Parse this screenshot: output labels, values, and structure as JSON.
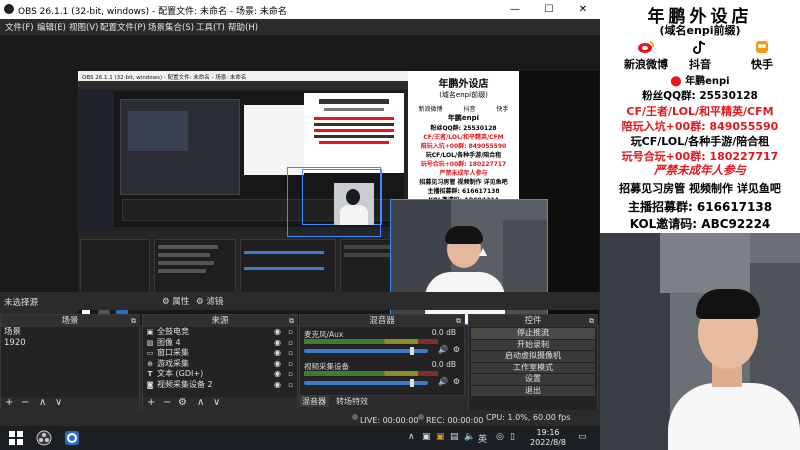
{
  "obs": {
    "title": "OBS 26.1.1 (32-bit, windows) - 配置文件: 未命名 - 场景: 未命名",
    "menu": [
      "文件(F)",
      "编辑(E)",
      "视图(V)",
      "配置文件(P)",
      "场景集合(S)",
      "工具(T)",
      "帮助(H)"
    ],
    "window_buttons": {
      "minimize": "—",
      "maximize": "☐",
      "close": "✕"
    },
    "nested_title": "OBS 26.1.1 (32-bit, windows) - 配置文件: 未命名 - 场景: 未命名",
    "no_source_selected": "未选择源",
    "properties_btn": "属性",
    "filters_btn": "滤镜",
    "docks": {
      "scenes": {
        "title": "场景",
        "items": [
          "场景",
          "1920"
        ]
      },
      "sources": {
        "title": "来源",
        "items": [
          {
            "icon": "window-capture-icon",
            "label": "全鼓电竞"
          },
          {
            "icon": "image-icon",
            "label": "图像 4"
          },
          {
            "icon": "window-capture-icon",
            "label": "窗口采集"
          },
          {
            "icon": "game-capture-icon",
            "label": "游戏采集"
          },
          {
            "icon": "text-icon",
            "label": "文本 (GDI+)"
          },
          {
            "icon": "camera-icon",
            "label": "视频采集设备 2"
          }
        ]
      },
      "mixer": {
        "title": "混音器",
        "channels": [
          {
            "name": "麦克风/Aux",
            "db": "0.0 dB",
            "level": 0.85
          },
          {
            "name": "视频采集设备",
            "db": "0.0 dB",
            "level": 0.85
          }
        ],
        "tabs": [
          "混音器",
          "转场特效"
        ]
      },
      "controls": {
        "title": "控件",
        "buttons": [
          "停止推流",
          "开始录制",
          "启动虚拟摄像机",
          "工作室模式",
          "设置",
          "退出"
        ]
      }
    },
    "status": {
      "live": "LIVE: 00:00:00",
      "rec": "REC: 00:00:00",
      "cpu": "CPU: 1.0%, 60.00 fps"
    }
  },
  "taskbar": {
    "time": "19:16",
    "date": "2022/8/8"
  },
  "poster": {
    "title": "年鹏外设店",
    "subtitle": "(域名enpi前缀)",
    "social": [
      "新浪微博",
      "抖音",
      "快手"
    ],
    "name": "年鹏enpi",
    "lines": [
      {
        "text": "粉丝QQ群: 25530128",
        "color": "#000000"
      },
      {
        "text": "CF/王者/LOL/和平精英/CFM",
        "color": "#e3171c"
      },
      {
        "text": "陪玩入坑+00群: 849055590",
        "color": "#e3171c"
      },
      {
        "text": "玩CF/LOL/各种手游/陪合租",
        "color": "#000000"
      },
      {
        "text": "玩号合玩+00群: 180227717",
        "color": "#e3171c"
      },
      {
        "text": "严禁未成年人参与",
        "color": "#e3171c"
      },
      {
        "text": "招募见习房管 视频制作 详见鱼吧",
        "color": "#000000"
      },
      {
        "text": "主播招募群: 616617138",
        "color": "#000000"
      },
      {
        "text": "KOL邀请码: ABC92224",
        "color": "#000000"
      }
    ]
  },
  "colors": {
    "accent": "#3c8cff",
    "poster_red": "#e3171c",
    "obs_bg": "#2b2b2b"
  }
}
